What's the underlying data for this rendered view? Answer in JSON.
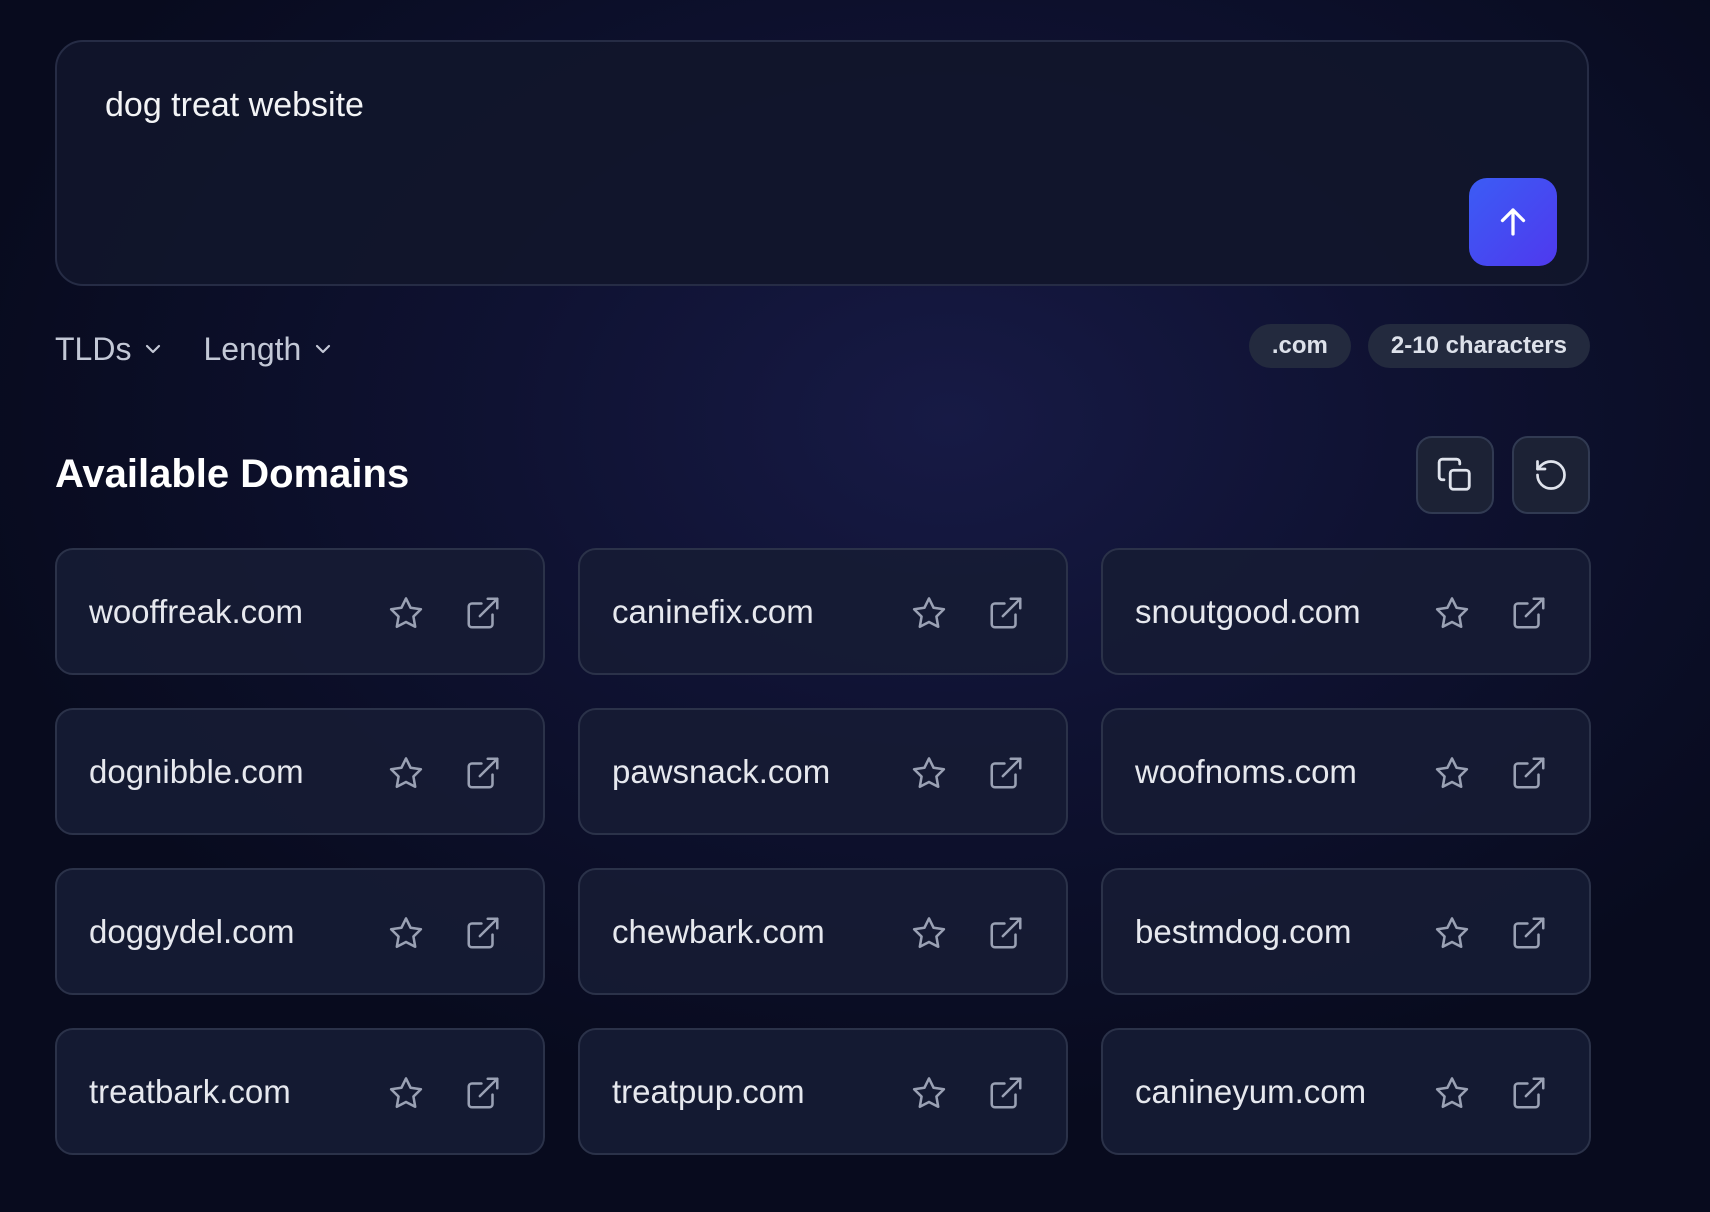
{
  "prompt": {
    "text": "dog treat website"
  },
  "filters": {
    "tlds_label": "TLDs",
    "length_label": "Length"
  },
  "chips": {
    "tld": ".com",
    "length": "2-10 characters"
  },
  "results": {
    "title": "Available Domains",
    "domains": [
      "wooffreak.com",
      "caninefix.com",
      "snoutgood.com",
      "dognibble.com",
      "pawsnack.com",
      "woofnoms.com",
      "doggydel.com",
      "chewbark.com",
      "bestmdog.com",
      "treatbark.com",
      "treatpup.com",
      "canineyum.com"
    ]
  },
  "icons": {
    "submit": "arrow-up-icon",
    "copy": "copy-icon",
    "refresh": "refresh-icon",
    "favorite": "star-icon",
    "open": "external-link-icon"
  },
  "colors": {
    "accent": "#4350f2",
    "background": "#0f1232"
  }
}
